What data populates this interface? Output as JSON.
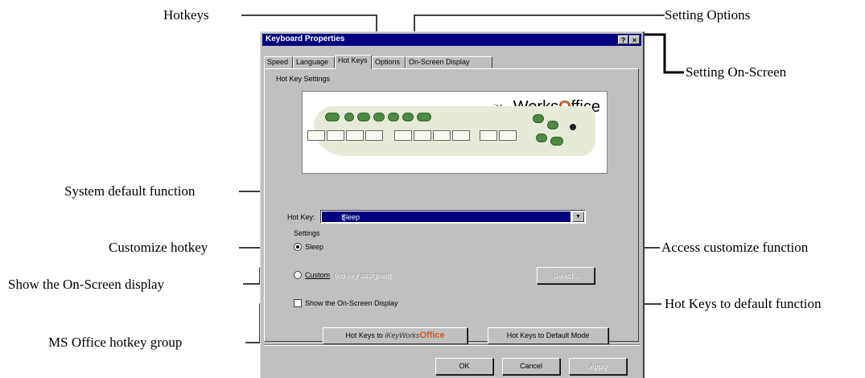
{
  "callouts": {
    "hotkeys": "Hotkeys",
    "setting_options": "Setting Options",
    "setting_onscreen": "Setting On-Screen",
    "system_default": "System default function",
    "customize_hotkey": "Customize hotkey",
    "access_customize": "Access customize function",
    "show_onscreen": "Show the On-Screen display",
    "hotkeys_default": "Hot Keys to default function",
    "ms_office_group": "MS Office hotkey group"
  },
  "dialog": {
    "title": "Keyboard Properties",
    "help_button": "?",
    "close_button": "×",
    "tabs": [
      "Speed",
      "Language",
      "Hot Keys",
      "Options",
      "On-Screen Display"
    ],
    "active_tab": "Hot Keys",
    "group_label": "Hot Key Settings",
    "logo": {
      "prefix": "iKey",
      "middle": "Works",
      "accent": "O",
      "suffix": "ffice"
    },
    "hotkey_label": "Hot Key:",
    "hotkey_value": "Sleep",
    "settings_label": "Settings",
    "sleep_radio": "Sleep",
    "custom_radio": "Custom",
    "custom_field": "(no key assigned)",
    "select_button": "Select...",
    "show_osd_checkbox": "Show the On-Screen Display",
    "office_button_prefix": "Hot Keys to",
    "default_button": "Hot Keys to Default Mode",
    "ok_button": "OK",
    "cancel_button": "Cancel",
    "apply_button": "Apply"
  }
}
